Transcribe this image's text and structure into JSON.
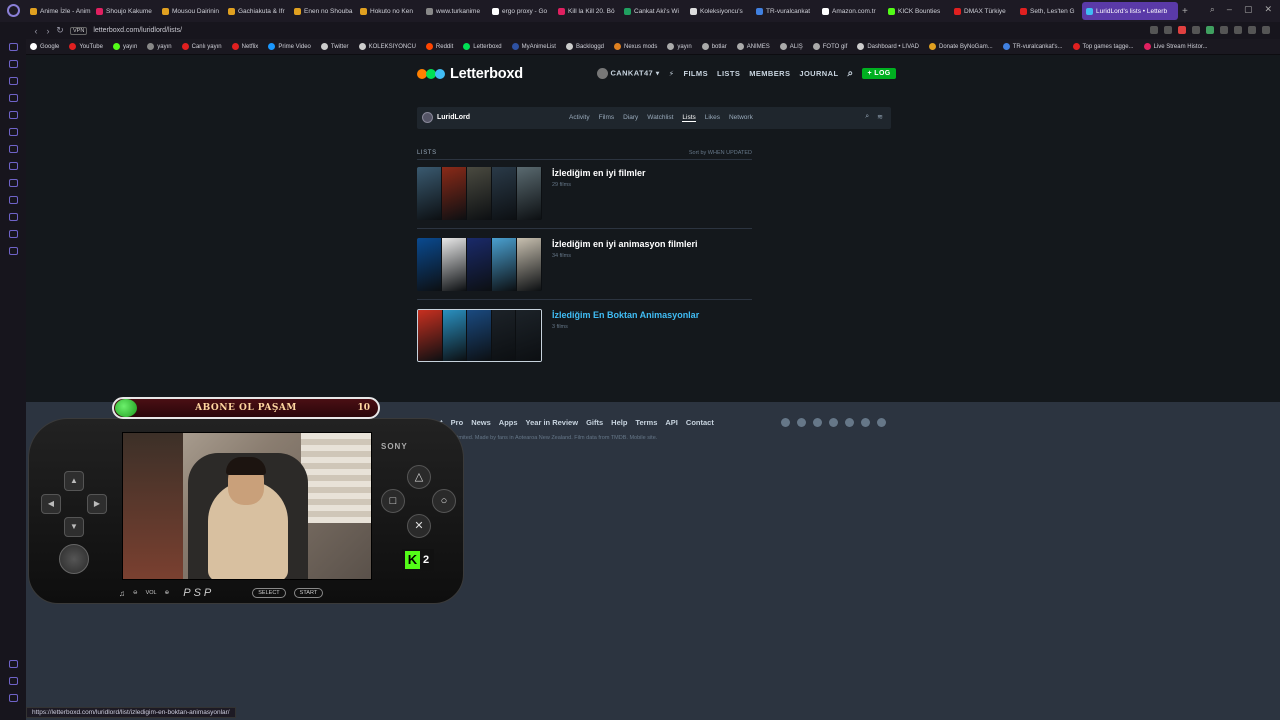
{
  "browser": {
    "tabs": [
      {
        "label": "Anime İzle - Anim",
        "color": "#e0a020"
      },
      {
        "label": "Shoujo Kakume",
        "color": "#e02060"
      },
      {
        "label": "Mousou Dairinin",
        "color": "#e0a020"
      },
      {
        "label": "Gachiakuta & Ifr",
        "color": "#e0a020"
      },
      {
        "label": "Enen no Shouba",
        "color": "#e0a020"
      },
      {
        "label": "Hokuto no Ken",
        "color": "#e0a020"
      },
      {
        "label": "www.turkanime",
        "color": "#888888"
      },
      {
        "label": "ergo proxy - Go",
        "color": "#ffffff"
      },
      {
        "label": "Kill la Kill 20. Bö",
        "color": "#e02060"
      },
      {
        "label": "Cankat Aki's Wi",
        "color": "#20a060"
      },
      {
        "label": "Koleksiyoncu's",
        "color": "#dddddd"
      },
      {
        "label": "TR-vuralcankat",
        "color": "#4080e0"
      },
      {
        "label": "Amazon.com.tr",
        "color": "#ffffff"
      },
      {
        "label": "KICK Bounties",
        "color": "#53fc18"
      },
      {
        "label": "DMAX Türkiye",
        "color": "#e02020"
      },
      {
        "label": "Seth, Les'ten G",
        "color": "#e02020"
      }
    ],
    "active_tab": {
      "label": "LuridLord's lists • Letterb",
      "color": "#40bcf4"
    },
    "url": "letterboxd.com/luridlord/lists/",
    "vpn": "VPN",
    "bookmarks": [
      {
        "label": "Google",
        "color": "#ffffff"
      },
      {
        "label": "YouTube",
        "color": "#e02020"
      },
      {
        "label": "yayın",
        "color": "#53fc18"
      },
      {
        "label": "yayın",
        "color": "#888888"
      },
      {
        "label": "Canlı yayın",
        "color": "#e02020"
      },
      {
        "label": "Netflix",
        "color": "#e02020"
      },
      {
        "label": "Prime Video",
        "color": "#1a98ff"
      },
      {
        "label": "Twitter",
        "color": "#cccccc"
      },
      {
        "label": "KOLEKSIYONCU",
        "color": "#cccccc"
      },
      {
        "label": "Reddit",
        "color": "#ff4500"
      },
      {
        "label": "Letterboxd",
        "color": "#00e054"
      },
      {
        "label": "MyAnimeList",
        "color": "#2e51a2"
      },
      {
        "label": "Backloggd",
        "color": "#cccccc"
      },
      {
        "label": "Nexus mods",
        "color": "#e08020"
      },
      {
        "label": "yayın",
        "color": "#aaaaaa"
      },
      {
        "label": "botlar",
        "color": "#aaaaaa"
      },
      {
        "label": "ANIMES",
        "color": "#aaaaaa"
      },
      {
        "label": "ALIŞ",
        "color": "#aaaaaa"
      },
      {
        "label": "FOTO gif",
        "color": "#aaaaaa"
      },
      {
        "label": "Dashboard • LIVAD",
        "color": "#cccccc"
      },
      {
        "label": "Donate ByNoGam...",
        "color": "#e0a020"
      },
      {
        "label": "TR-vuralcankat's...",
        "color": "#4080e0"
      },
      {
        "label": "Top games tagge...",
        "color": "#e02020"
      },
      {
        "label": "Live Stream Histor...",
        "color": "#e02060"
      }
    ],
    "status_url": "https://letterboxd.com/luridlord/list/izledigim-en-boktan-animasyonlar/"
  },
  "header": {
    "logo_text": "Letterboxd",
    "user": "CANKAT47",
    "nav": [
      "FILMS",
      "LISTS",
      "MEMBERS",
      "JOURNAL"
    ],
    "log_button": "+ LOG"
  },
  "profile": {
    "name": "LuridLord",
    "tabs": [
      "Activity",
      "Films",
      "Diary",
      "Watchlist",
      "Lists",
      "Likes",
      "Network"
    ],
    "active_tab": "Lists"
  },
  "lists_section": {
    "label": "LISTS",
    "sort": "Sort by WHEN UPDATED",
    "items": [
      {
        "title": "İzlediğim en iyi filmler",
        "count": "29 films",
        "posters": [
          "#3a5a70",
          "#8a2a18",
          "#4a4a40",
          "#2a3a48",
          "#5a6a70"
        ]
      },
      {
        "title": "İzlediğim en iyi animasyon filmleri",
        "count": "34 films",
        "posters": [
          "#0a4a90",
          "#e8e8e8",
          "#1a2a6a",
          "#4aa0d0",
          "#c8c0b0"
        ]
      },
      {
        "title": "İzlediğim En Boktan Animasyonlar",
        "count": "3 films",
        "posters": [
          "#c83020",
          "#2a90c0",
          "#1a4a80",
          "#1c2228",
          "#1c2228"
        ]
      }
    ]
  },
  "footer": {
    "links": [
      "About",
      "Pro",
      "News",
      "Apps",
      "Year in Review",
      "Gifts",
      "Help",
      "Terms",
      "API",
      "Contact"
    ],
    "copyright": "© Letterboxd Limited. Made by fans in Aotearoa New Zealand. Film data from TMDB. Mobile site."
  },
  "overlay": {
    "subscribe_text": "ABONE OL PAŞAM",
    "subscribe_count": "10",
    "brand": "SONY",
    "vol_label": "VOL",
    "psp_logo": "PSP",
    "select_label": "SELECT",
    "start_label": "START",
    "kick_count": "2"
  }
}
